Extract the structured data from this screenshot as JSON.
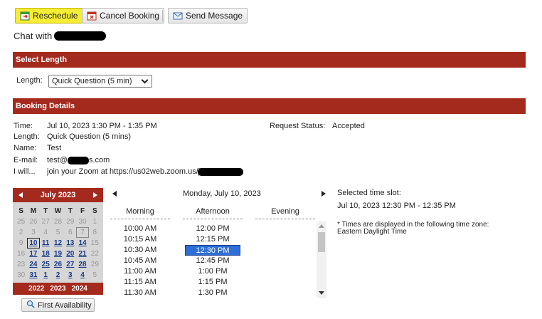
{
  "toolbar": {
    "reschedule": "Reschedule",
    "cancel": "Cancel Booking",
    "send": "Send Message"
  },
  "chat_with": "Chat with",
  "select_length": {
    "header": "Select Length",
    "label": "Length:",
    "value": "Quick Question (5 min)"
  },
  "booking": {
    "header": "Booking Details",
    "time_label": "Time:",
    "time_value": "Jul 10, 2023 1:30 PM - 1:35 PM",
    "length_label": "Length:",
    "length_value": "Quick Question (5 mins)",
    "name_label": "Name:",
    "name_value": "Test",
    "email_label": "E-mail:",
    "email_pre": "test@",
    "email_post": "s.com",
    "iwill_label": "I will...",
    "iwill_value": "join your Zoom at https://us02web.zoom.us/j",
    "status_label": "Request Status:",
    "status_value": "Accepted"
  },
  "calendar": {
    "month": "July 2023",
    "dows": [
      "S",
      "M",
      "T",
      "W",
      "T",
      "F",
      "S"
    ],
    "weeks": [
      [
        "25",
        "26",
        "27",
        "28",
        "29",
        "30",
        "1"
      ],
      [
        "2",
        "3",
        "4",
        "5",
        "6",
        "7",
        "8"
      ],
      [
        "9",
        "10",
        "11",
        "12",
        "13",
        "14",
        "15"
      ],
      [
        "16",
        "17",
        "18",
        "19",
        "20",
        "21",
        "22"
      ],
      [
        "23",
        "24",
        "25",
        "26",
        "27",
        "28",
        "29"
      ],
      [
        "30",
        "31",
        "1",
        "2",
        "3",
        "4",
        "5"
      ]
    ],
    "years": [
      "2022",
      "2023",
      "2024"
    ],
    "first_availability": "First Availability"
  },
  "schedule": {
    "date": "Monday, July 10, 2023",
    "morning_label": "Morning",
    "afternoon_label": "Afternoon",
    "evening_label": "Evening",
    "morning": [
      "10:00 AM",
      "10:15 AM",
      "10:30 AM",
      "10:45 AM",
      "11:00 AM",
      "11:15 AM",
      "11:30 AM"
    ],
    "afternoon": [
      "12:00 PM",
      "12:15 PM",
      "12:30 PM",
      "12:45 PM",
      "1:00 PM",
      "1:15 PM",
      "1:30 PM"
    ],
    "selected": "12:30 PM"
  },
  "selected_slot": {
    "label": "Selected time slot:",
    "value": "Jul 10, 2023 12:30 PM - 12:35 PM",
    "tz_note_1": "* Times are displayed in the following time zone:",
    "tz_note_2": "Eastern Daylight Time"
  },
  "colors": {
    "accent": "#a52a1e",
    "selection": "#2d6fd6",
    "primary_button": "#f6ee34",
    "link": "#1a3a8a"
  }
}
